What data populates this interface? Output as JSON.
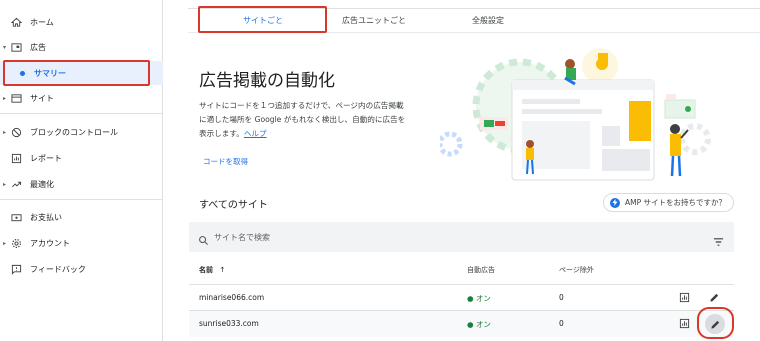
{
  "sidebar": {
    "items": [
      {
        "label": "ホーム",
        "icon": "home-icon"
      },
      {
        "label": "広告",
        "icon": "ads-icon"
      },
      {
        "label": "サマリー",
        "icon": "dot-icon"
      },
      {
        "label": "サイト",
        "icon": "site-icon"
      },
      {
        "label": "ブロックのコントロール",
        "icon": "block-icon"
      },
      {
        "label": "レポート",
        "icon": "report-icon"
      },
      {
        "label": "最適化",
        "icon": "optimize-icon"
      },
      {
        "label": "お支払い",
        "icon": "payment-icon"
      },
      {
        "label": "アカウント",
        "icon": "gear-icon"
      },
      {
        "label": "フィードバック",
        "icon": "feedback-icon"
      }
    ]
  },
  "tabs": [
    {
      "label": "サイトごと"
    },
    {
      "label": "広告ユニットごと"
    },
    {
      "label": "全般設定"
    }
  ],
  "hero": {
    "title": "広告掲載の自動化",
    "desc_lines": [
      "サイトにコードを１つ追加するだけで、ページ内の広告掲載",
      "に適した場所を Google がもれなく検出し、自動的に広告を",
      "表示します。"
    ],
    "help": "ヘルプ",
    "code_link": "コードを取得"
  },
  "sites": {
    "title": "すべてのサイト",
    "amp_button": "AMP サイトをお持ちですか？",
    "search_placeholder": "サイト名で検索",
    "columns": {
      "name": "名前",
      "sort": "↑",
      "auto_ads": "自動広告",
      "page_excl": "ページ除外"
    },
    "rows": [
      {
        "name": "minarise066.com",
        "auto_ads": "オン",
        "page_excl": "0"
      },
      {
        "name": "sunrise033.com",
        "auto_ads": "オン",
        "page_excl": "0"
      }
    ]
  },
  "colors": {
    "accent": "#1a73e8",
    "highlight": "#d9372b",
    "on": "#188038"
  }
}
